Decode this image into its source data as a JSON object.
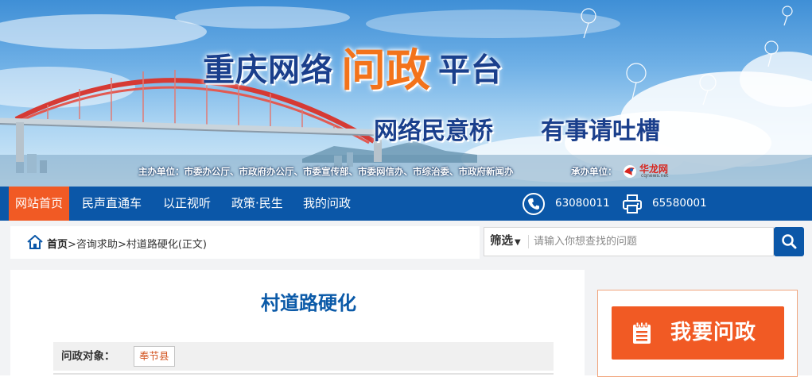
{
  "banner": {
    "title_part1": "重庆网络",
    "title_highlight": "问政",
    "title_part2": "平台",
    "slogan_1": "网络民意桥",
    "slogan_2": "有事请吐槽",
    "sponsors": "主办单位：市委办公厅、市政府办公厅、市委宣传部、市委网信办、市综治委、市政府新闻办",
    "organizer": "承办单位：",
    "logo_name": "华龙网",
    "logo_domain": "cqnews.net"
  },
  "nav": {
    "items": [
      "网站首页",
      "民声直通车",
      "以正视听",
      "政策·民生",
      "我的问政"
    ],
    "phone": "63080011",
    "fax": "65580001",
    "icons": [
      "phone-icon",
      "fax-icon"
    ]
  },
  "breadcrumb": {
    "home": "首页",
    "sep1": ">",
    "section": "咨询求助",
    "sep2": ">",
    "current": "村道路硬化(正文)"
  },
  "search": {
    "filter_label": "筛选",
    "filter_caret": "▼",
    "placeholder": "请输入你想查找的问题"
  },
  "article": {
    "title": "村道路硬化",
    "target_label": "问政对象：",
    "target_value": "奉节县"
  },
  "sidebar": {
    "ask_button": "我要问政"
  },
  "colors": {
    "nav_blue": "#0b57a8",
    "accent_orange": "#f15a24",
    "title_blue": "#0b5aa8"
  }
}
